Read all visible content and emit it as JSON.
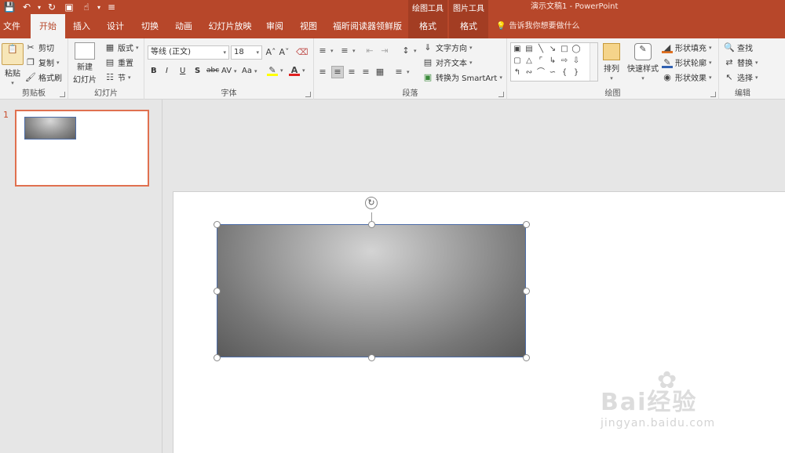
{
  "app": {
    "doc_title": "演示文稿1  -  PowerPoint",
    "quick_access": [
      "save-icon",
      "undo-icon",
      "redo-icon",
      "present-icon",
      "touch-mode-icon",
      "customize-icon"
    ]
  },
  "context_groups": {
    "drawing_tools": "绘图工具",
    "picture_tools": "图片工具"
  },
  "tabs": [
    {
      "label": "文件"
    },
    {
      "label": "开始"
    },
    {
      "label": "插入"
    },
    {
      "label": "设计"
    },
    {
      "label": "切换"
    },
    {
      "label": "动画"
    },
    {
      "label": "幻灯片放映"
    },
    {
      "label": "审阅"
    },
    {
      "label": "视图"
    },
    {
      "label": "福昕阅读器领鲜版"
    },
    {
      "label": "格式"
    },
    {
      "label": "格式"
    }
  ],
  "tell_me": "告诉我你想要做什么",
  "ribbon": {
    "clipboard": {
      "label": "剪贴板",
      "paste": "粘贴",
      "cut": "剪切",
      "copy": "复制",
      "format_painter": "格式刷"
    },
    "slides": {
      "label": "幻灯片",
      "new_slide_1": "新建",
      "new_slide_2": "幻灯片",
      "layout": "版式",
      "reset": "重置",
      "section": "节"
    },
    "font": {
      "label": "字体",
      "font_name": "等线 (正文)",
      "font_size": "18",
      "bold": "B",
      "italic": "I",
      "underline": "U",
      "shadow": "S",
      "strike": "abc",
      "spacing": "AV",
      "case": "Aa"
    },
    "paragraph": {
      "label": "段落",
      "text_direction": "文字方向",
      "align_text": "对齐文本",
      "smartart": "转换为 SmartArt"
    },
    "drawing": {
      "label": "绘图",
      "arrange": "排列",
      "quick_styles": "快速样式",
      "shape_fill": "形状填充",
      "shape_outline": "形状轮廓",
      "shape_effects": "形状效果"
    },
    "editing": {
      "label": "编辑",
      "find": "查找",
      "replace": "替换",
      "select": "选择"
    }
  },
  "slides_panel": {
    "slide_number": "1"
  },
  "watermark": {
    "main": "Bai经验",
    "sub": "jingyan.baidu.com"
  }
}
